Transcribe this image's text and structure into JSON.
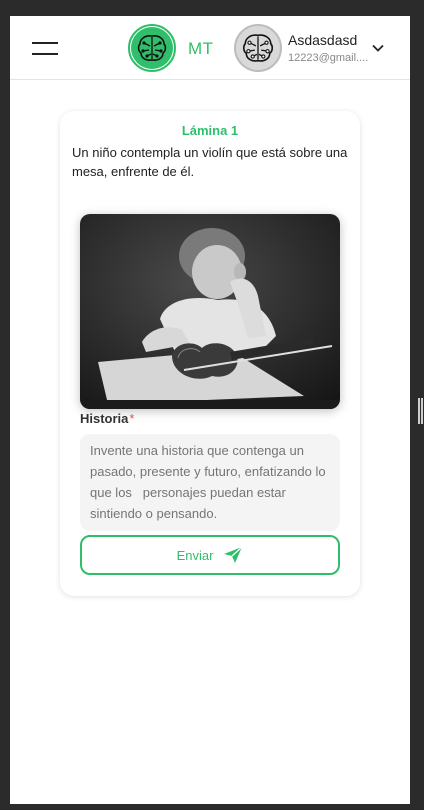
{
  "header": {
    "brand": "MT",
    "user_name": "Asdasdasd",
    "user_email": "12223@gmail...."
  },
  "card": {
    "title": "Lámina 1",
    "description": "Un niño contempla un violín que está sobre una mesa, enfrente de él.",
    "field_label": "Historia",
    "required_mark": "*",
    "placeholder": "Invente una historia que contenga un pasado, presente y futuro, enfatizando lo que los   personajes puedan estar sintiendo o pensando.",
    "submit_label": "Enviar"
  },
  "icons": {
    "menu": "hamburger-menu-icon",
    "logo": "brain-circuit-logo",
    "avatar": "brain-circuit-avatar",
    "dropdown": "chevron-down-icon",
    "send": "send-plane-icon"
  },
  "colors": {
    "accent": "#2fbf6a",
    "required": "#e05454"
  }
}
